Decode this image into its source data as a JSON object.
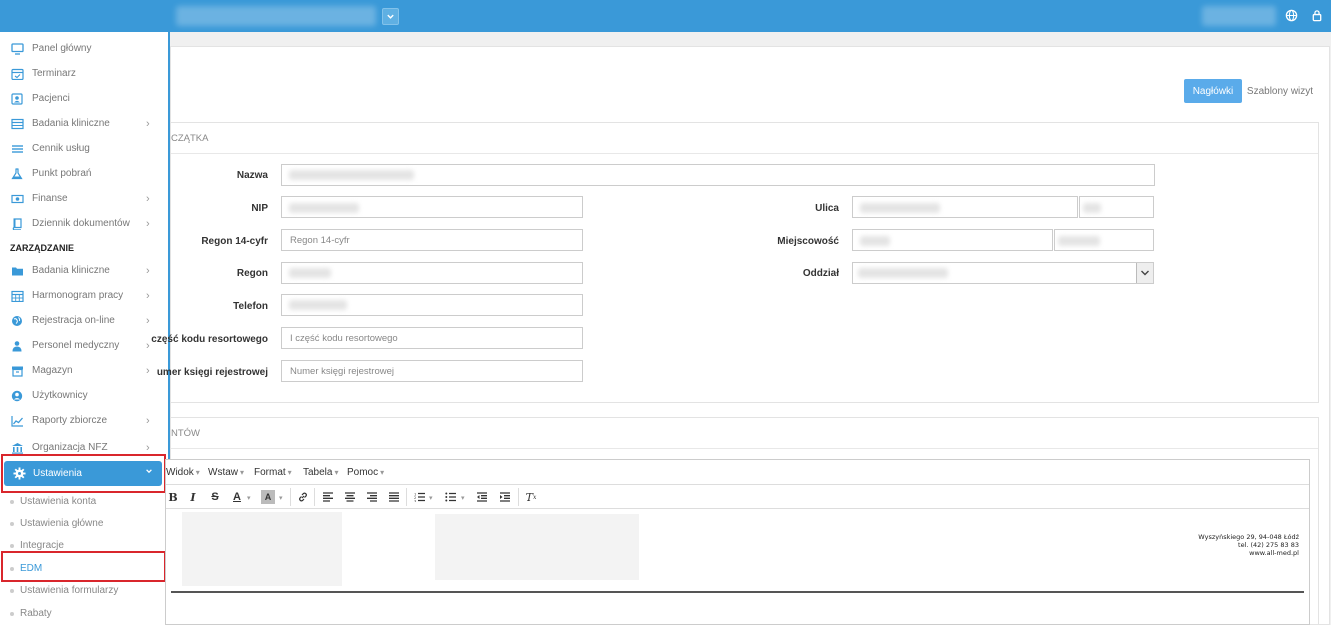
{
  "sidebar": {
    "items": [
      {
        "label": "Panel główny",
        "icon": "monitor-icon"
      },
      {
        "label": "Terminarz",
        "icon": "calendar-check-icon"
      },
      {
        "label": "Pacjenci",
        "icon": "user-card-icon"
      },
      {
        "label": "Badania kliniczne",
        "icon": "table-icon",
        "chevron": true
      },
      {
        "label": "Cennik usług",
        "icon": "list-icon"
      },
      {
        "label": "Punkt pobrań",
        "icon": "flask-icon"
      },
      {
        "label": "Finanse",
        "icon": "money-icon",
        "chevron": true
      },
      {
        "label": "Dziennik dokumentów",
        "icon": "book-icon",
        "chevron": true
      }
    ],
    "section_label": "ZARZĄDZANIE",
    "mgmt_items": [
      {
        "label": "Badania kliniczne",
        "icon": "folder-icon",
        "chevron": true
      },
      {
        "label": "Harmonogram pracy",
        "icon": "calendar-icon",
        "chevron": true
      },
      {
        "label": "Rejestracja on-line",
        "icon": "globe-icon",
        "chevron": true
      },
      {
        "label": "Personel medyczny",
        "icon": "doctor-icon",
        "chevron": true
      },
      {
        "label": "Magazyn",
        "icon": "box-icon",
        "chevron": true
      },
      {
        "label": "Użytkownicy",
        "icon": "user-circle-icon"
      },
      {
        "label": "Raporty zbiorcze",
        "icon": "chart-line-icon",
        "chevron": true
      },
      {
        "label": "Organizacja NFZ",
        "icon": "bank-icon",
        "chevron": true
      }
    ],
    "active_item": {
      "label": "Ustawienia",
      "icon": "gear-icon"
    },
    "sub_items": [
      {
        "label": "Ustawienia konta"
      },
      {
        "label": "Ustawienia główne"
      },
      {
        "label": "Integracje"
      },
      {
        "label": "EDM",
        "active": true
      },
      {
        "label": "Ustawienia formularzy"
      },
      {
        "label": "Rabaty"
      }
    ]
  },
  "tabs": {
    "active": "Nagłówki",
    "inactive": "Szablony wizyt"
  },
  "header_card": {
    "title": "CZĄTKA",
    "labels": {
      "nazwa": "Nazwa",
      "nip": "NIP",
      "regon14": "Regon 14-cyfr",
      "regon": "Regon",
      "telefon": "Telefon",
      "kod": "część kodu resortowego",
      "ksiega": "umer księgi rejestrowej",
      "ulica": "Ulica",
      "miejscowosc": "Miejscowość",
      "oddzial": "Oddział"
    },
    "placeholders": {
      "regon14": "Regon 14-cyfr",
      "kod": "I część kodu resortowego",
      "ksiega": "Numer księgi rejestrowej"
    }
  },
  "docs_card": {
    "title": "NTÓW",
    "menu": [
      {
        "label": "Widok"
      },
      {
        "label": "Wstaw"
      },
      {
        "label": "Format"
      },
      {
        "label": "Tabela"
      },
      {
        "label": "Pomoc"
      }
    ],
    "address_lines": [
      "Wyszyńskiego 29, 94-048 Łódź",
      "tel. (42) 275 83 83",
      "www.all-med.pl"
    ]
  },
  "colors": {
    "brand": "#3a99d8",
    "highlight": "#d9262c",
    "tab_active": "#5aabea"
  }
}
